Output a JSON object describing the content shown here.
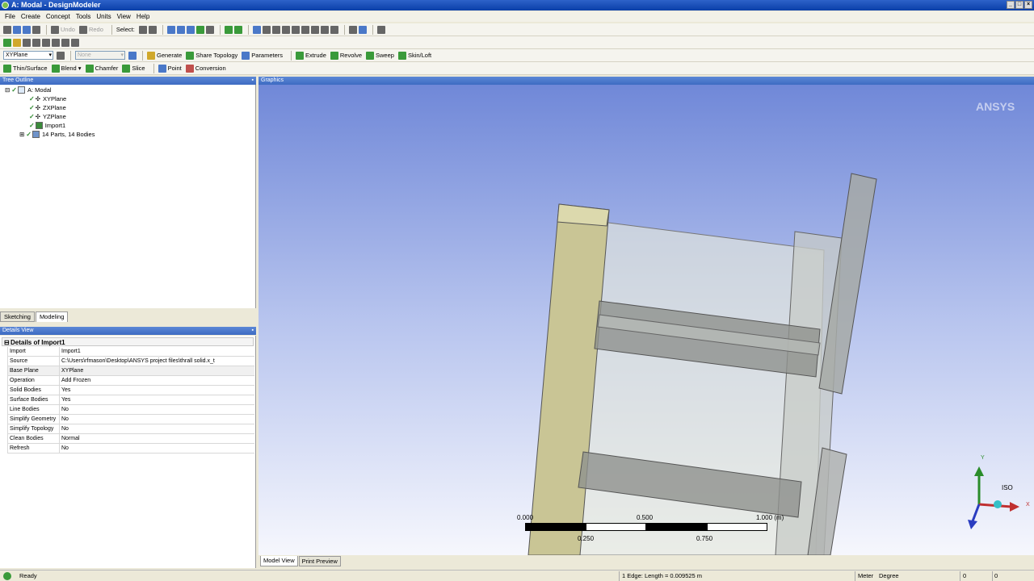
{
  "window": {
    "title": "A: Modal - DesignModeler"
  },
  "menu": [
    "File",
    "Create",
    "Concept",
    "Tools",
    "Units",
    "View",
    "Help"
  ],
  "toolbar1": {
    "undo": "Undo",
    "redo": "Redo",
    "select": "Select:"
  },
  "toolbar3": {
    "plane_select": "XYPlane",
    "sketch_select": "None",
    "generate": "Generate",
    "share_topology": "Share Topology",
    "parameters": "Parameters",
    "extrude": "Extrude",
    "revolve": "Revolve",
    "sweep": "Sweep",
    "skin_loft": "Skin/Loft"
  },
  "toolbar4": {
    "thin_surface": "Thin/Surface",
    "blend": "Blend",
    "chamfer": "Chamfer",
    "slice": "Slice",
    "point": "Point",
    "conversion": "Conversion"
  },
  "tree": {
    "header": "Tree Outline",
    "root": "A: Modal",
    "items": [
      "XYPlane",
      "ZXPlane",
      "YZPlane",
      "Import1",
      "14 Parts, 14 Bodies"
    ]
  },
  "tabs": {
    "sketching": "Sketching",
    "modeling": "Modeling"
  },
  "details": {
    "header": "Details View",
    "title": "Details of Import1",
    "rows": [
      {
        "key": "Import",
        "value": "Import1"
      },
      {
        "key": "Source",
        "value": "C:\\Users\\rfmason\\Desktop\\ANSYS project files\\thrall solid.x_t"
      },
      {
        "key": "Base Plane",
        "value": "XYPlane"
      },
      {
        "key": "Operation",
        "value": "Add Frozen"
      },
      {
        "key": "Solid Bodies",
        "value": "Yes"
      },
      {
        "key": "Surface Bodies",
        "value": "Yes"
      },
      {
        "key": "Line Bodies",
        "value": "No"
      },
      {
        "key": "Simplify Geometry",
        "value": "No"
      },
      {
        "key": "Simplify Topology",
        "value": "No"
      },
      {
        "key": "Clean Bodies",
        "value": "Normal"
      },
      {
        "key": "Refresh",
        "value": "No"
      }
    ]
  },
  "graphics": {
    "header": "Graphics",
    "logo": "ANSYS",
    "scale": {
      "t0": "0.000",
      "t1": "0.250",
      "t2": "0.500",
      "t3": "0.750",
      "t4": "1.000 (m)"
    },
    "triad": {
      "x": "X",
      "y": "Y",
      "iso": "ISO"
    }
  },
  "graphics_tabs": {
    "model_view": "Model View",
    "print_preview": "Print Preview"
  },
  "status": {
    "ready": "Ready",
    "selection": "1 Edge: Length = 0.009525 m",
    "units_len": "Meter",
    "units_ang": "Degree",
    "v1": "0",
    "v2": "0"
  }
}
